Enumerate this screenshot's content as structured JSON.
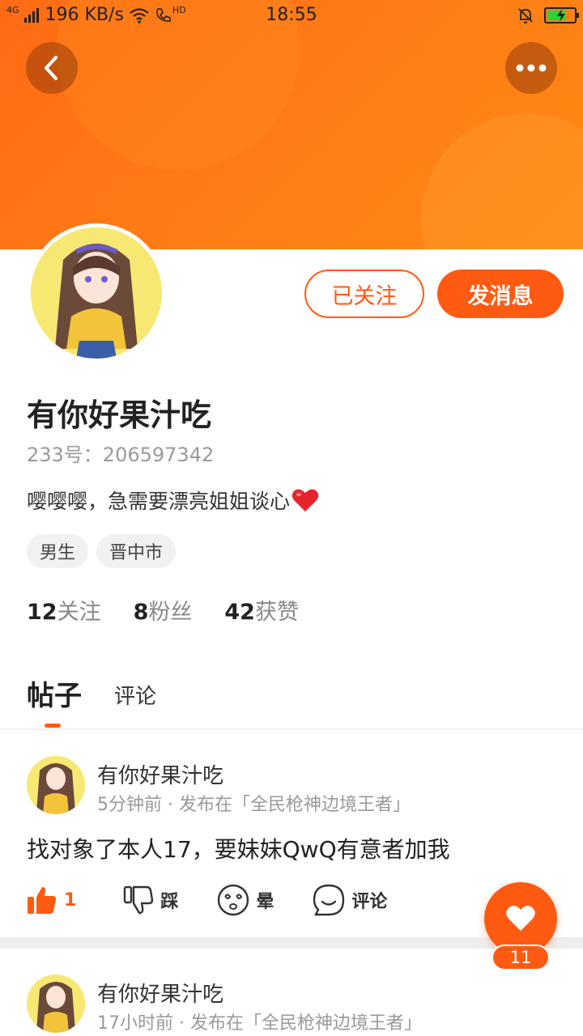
{
  "status_bar": {
    "network": "4G",
    "speed": "196 KB/s",
    "hd": "HD",
    "time": "18:55"
  },
  "header": {
    "back_icon": "chevron-left-icon",
    "more_icon": "more-horizontal-icon"
  },
  "profile": {
    "follow_label": "已关注",
    "message_label": "发消息",
    "name": "有你好果汁吃",
    "id_text": "233号：206597342",
    "bio": "嘤嘤嘤，急需要漂亮姐姐谈心",
    "tags": [
      "男生",
      "晋中市"
    ],
    "stats": [
      {
        "num": "12",
        "label": "关注"
      },
      {
        "num": "8",
        "label": "粉丝"
      },
      {
        "num": "42",
        "label": "获赞"
      }
    ]
  },
  "tabs": {
    "active": "帖子",
    "other": "评论"
  },
  "posts": [
    {
      "author": "有你好果汁吃",
      "meta": "5分钟前 · 发布在「全民枪神边境王者」",
      "text": "找对象了本人17，要妹妹QwQ有意者加我",
      "likes": "1",
      "dislike_label": "踩",
      "dizzy_label": "晕",
      "comment_label": "评论"
    },
    {
      "author": "有你好果汁吃",
      "meta": "17小时前 · 发布在「全民枪神边境王者」"
    }
  ],
  "float_like": {
    "count": "11"
  },
  "colors": {
    "accent": "#ff5a12",
    "banner": "#ff7a16"
  }
}
